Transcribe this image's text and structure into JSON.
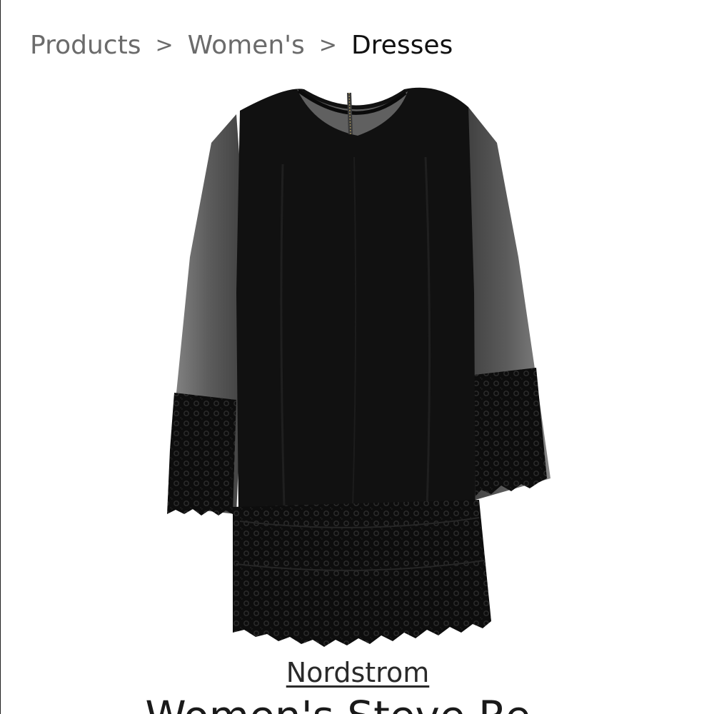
{
  "breadcrumb": {
    "items": [
      {
        "label": "Products",
        "current": false
      },
      {
        "label": "Women's",
        "current": false
      },
      {
        "label": "Dresses",
        "current": true
      }
    ],
    "separator": ">"
  },
  "product": {
    "image_alt": "Black dress with sheer mesh long sleeves and lace trim",
    "brand": "Nordstrom",
    "title_partial": "Women's Steve Re..."
  },
  "colors": {
    "breadcrumb_text": "#6b6b6b",
    "breadcrumb_current": "#111111",
    "dress": "#111111",
    "mesh": "#5a5a5a"
  }
}
